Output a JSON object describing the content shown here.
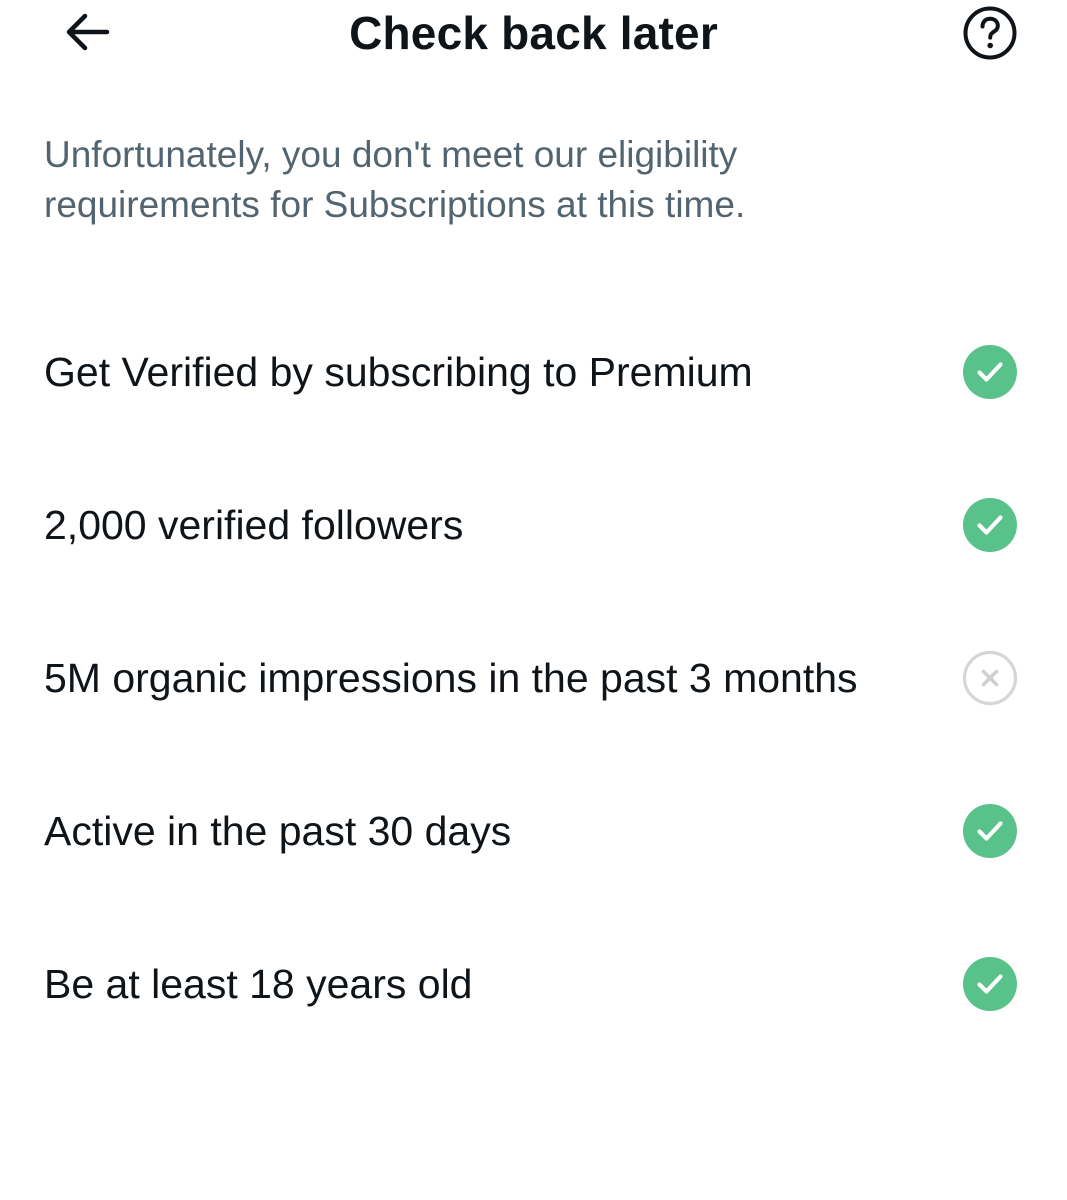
{
  "header": {
    "title": "Check back later",
    "back_icon": "arrow-left-icon",
    "help_icon": "question-circle-icon"
  },
  "description": {
    "line1": "Unfortunately, you don't meet our eligibility",
    "line2": "requirements for Subscriptions at this time."
  },
  "colors": {
    "met": "#59c18a",
    "unmet": "#d6d6d6",
    "text": "#0f1419",
    "muted": "#536471"
  },
  "requirements": [
    {
      "label": "Get Verified by subscribing to Premium",
      "status": "met",
      "icon": "check-circle-icon"
    },
    {
      "label": "2,000 verified followers",
      "status": "met",
      "icon": "check-circle-icon"
    },
    {
      "label": "5M organic impressions in the past 3 months",
      "status": "unmet",
      "icon": "x-circle-icon"
    },
    {
      "label": "Active in the past 30 days",
      "status": "met",
      "icon": "check-circle-icon"
    },
    {
      "label": "Be at least 18 years old",
      "status": "met",
      "icon": "check-circle-icon"
    }
  ]
}
